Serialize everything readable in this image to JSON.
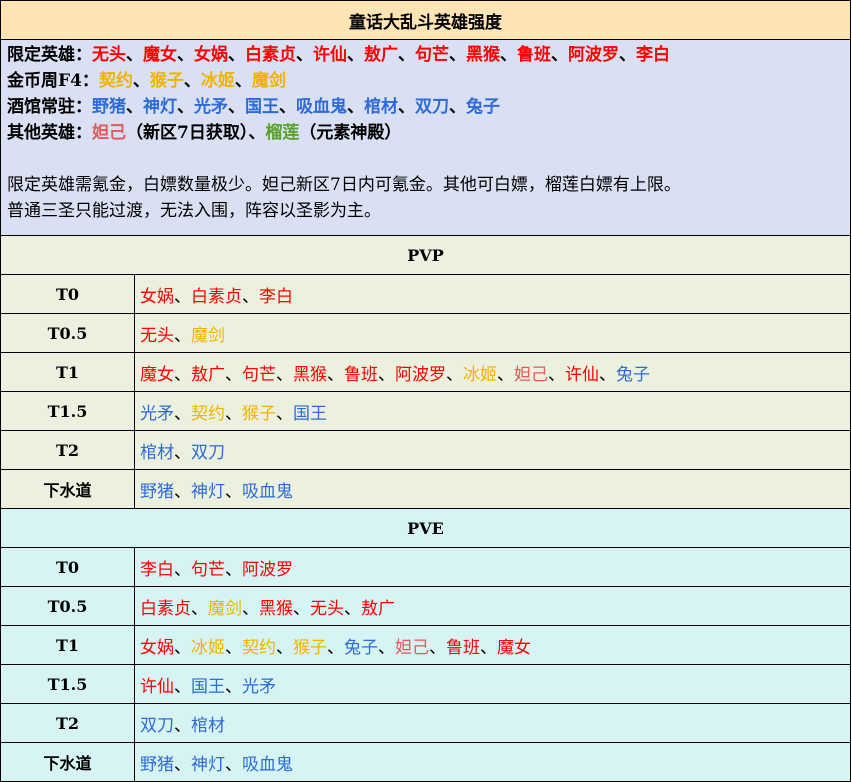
{
  "title": "童话大乱斗英雄强度",
  "colors": {
    "red": "#ff0000",
    "gold": "#f2b200",
    "blue": "#2e6bd6",
    "green": "#5aa02c",
    "pink": "#e8575a",
    "black": "#000000",
    "title_bg": "#fce4b5",
    "intro_bg": "#d9e0f3",
    "pvp_bg": "#ebf1de",
    "pve_bg": "#d6f4f3"
  },
  "intro": {
    "limited": {
      "label": "限定英雄：",
      "heroes": [
        {
          "name": "无头",
          "color": "red"
        },
        {
          "name": "魔女",
          "color": "red"
        },
        {
          "name": "女娲",
          "color": "red"
        },
        {
          "name": "白素贞",
          "color": "red"
        },
        {
          "name": "许仙",
          "color": "red"
        },
        {
          "name": "敖广",
          "color": "red"
        },
        {
          "name": "句芒",
          "color": "red"
        },
        {
          "name": "黑猴",
          "color": "red"
        },
        {
          "name": "鲁班",
          "color": "red"
        },
        {
          "name": "阿波罗",
          "color": "red"
        },
        {
          "name": "李白",
          "color": "red"
        }
      ]
    },
    "coin": {
      "label": "金币周F4：",
      "heroes": [
        {
          "name": "契约",
          "color": "gold"
        },
        {
          "name": "猴子",
          "color": "gold"
        },
        {
          "name": "冰姬",
          "color": "gold"
        },
        {
          "name": "魔剑",
          "color": "gold"
        }
      ]
    },
    "tavern": {
      "label": "酒馆常驻：",
      "heroes": [
        {
          "name": "野猪",
          "color": "blue"
        },
        {
          "name": "神灯",
          "color": "blue"
        },
        {
          "name": "光矛",
          "color": "blue"
        },
        {
          "name": "国王",
          "color": "blue"
        },
        {
          "name": "吸血鬼",
          "color": "blue"
        },
        {
          "name": "棺材",
          "color": "blue"
        },
        {
          "name": "双刀",
          "color": "blue"
        },
        {
          "name": "兔子",
          "color": "blue"
        }
      ]
    },
    "other": {
      "label": "其他英雄：",
      "hero1": "妲己",
      "hero1_note": "（新区7日获取）",
      "hero2": "榴莲",
      "hero2_note": "（元素神殿）"
    },
    "note1": "限定英雄需氪金，白嫖数量极少。妲己新区7日内可氪金。其他可白嫖，榴莲白嫖有上限。",
    "note2": "普通三圣只能过渡，无法入围，阵容以圣影为主。"
  },
  "pvp": {
    "header": "PVP",
    "tiers": [
      {
        "label": "T0",
        "heroes": [
          {
            "name": "女娲 ",
            "color": "red"
          },
          {
            "name": "白素贞",
            "color": "red"
          },
          {
            "name": "李白",
            "color": "red"
          }
        ]
      },
      {
        "label": "T0.5",
        "heroes": [
          {
            "name": "无头",
            "color": "red"
          },
          {
            "name": "魔剑",
            "color": "gold"
          }
        ]
      },
      {
        "label": "T1",
        "heroes": [
          {
            "name": "魔女",
            "color": "red"
          },
          {
            "name": "敖广",
            "color": "red"
          },
          {
            "name": "句芒",
            "color": "red"
          },
          {
            "name": "黑猴",
            "color": "red"
          },
          {
            "name": "鲁班",
            "color": "red"
          },
          {
            "name": "阿波罗",
            "color": "red"
          },
          {
            "name": "冰姬",
            "color": "gold"
          },
          {
            "name": "妲己",
            "color": "pink"
          },
          {
            "name": "许仙",
            "color": "red"
          },
          {
            "name": "兔子",
            "color": "blue"
          }
        ]
      },
      {
        "label": "T1.5",
        "heroes": [
          {
            "name": "光矛",
            "color": "blue"
          },
          {
            "name": "契约",
            "color": "gold"
          },
          {
            "name": "猴子",
            "color": "gold"
          },
          {
            "name": "国王",
            "color": "blue"
          }
        ]
      },
      {
        "label": "T2",
        "heroes": [
          {
            "name": "棺材",
            "color": "blue"
          },
          {
            "name": "双刀",
            "color": "blue"
          }
        ]
      },
      {
        "label": "下水道",
        "heroes": [
          {
            "name": "野猪",
            "color": "blue"
          },
          {
            "name": "神灯",
            "color": "blue"
          },
          {
            "name": "吸血鬼",
            "color": "blue"
          }
        ]
      }
    ]
  },
  "pve": {
    "header": "PVE",
    "tiers": [
      {
        "label": "T0",
        "heroes": [
          {
            "name": "李白",
            "color": "red"
          },
          {
            "name": "句芒",
            "color": "red"
          },
          {
            "name": "阿波罗",
            "color": "red"
          }
        ]
      },
      {
        "label": "T0.5",
        "heroes": [
          {
            "name": "白素贞",
            "color": "red"
          },
          {
            "name": "魔剑",
            "color": "gold"
          },
          {
            "name": "黑猴",
            "color": "red"
          },
          {
            "name": "无头",
            "color": "red"
          },
          {
            "name": "敖广",
            "color": "red"
          }
        ]
      },
      {
        "label": "T1",
        "heroes": [
          {
            "name": "女娲",
            "color": "red"
          },
          {
            "name": "冰姬",
            "color": "gold"
          },
          {
            "name": "契约",
            "color": "gold"
          },
          {
            "name": "猴子",
            "color": "gold"
          },
          {
            "name": "兔子",
            "color": "blue"
          },
          {
            "name": "妲己",
            "color": "pink"
          },
          {
            "name": "鲁班",
            "color": "red"
          },
          {
            "name": "魔女",
            "color": "red"
          }
        ]
      },
      {
        "label": "T1.5",
        "heroes": [
          {
            "name": "许仙",
            "color": "red"
          },
          {
            "name": "国王",
            "color": "blue"
          },
          {
            "name": "光矛",
            "color": "blue"
          }
        ]
      },
      {
        "label": "T2",
        "heroes": [
          {
            "name": "双刀",
            "color": "blue"
          },
          {
            "name": "棺材",
            "color": "blue"
          }
        ]
      },
      {
        "label": "下水道",
        "heroes": [
          {
            "name": "野猪",
            "color": "blue"
          },
          {
            "name": "神灯",
            "color": "blue"
          },
          {
            "name": "吸血鬼",
            "color": "blue"
          }
        ]
      }
    ]
  },
  "separator": "、"
}
